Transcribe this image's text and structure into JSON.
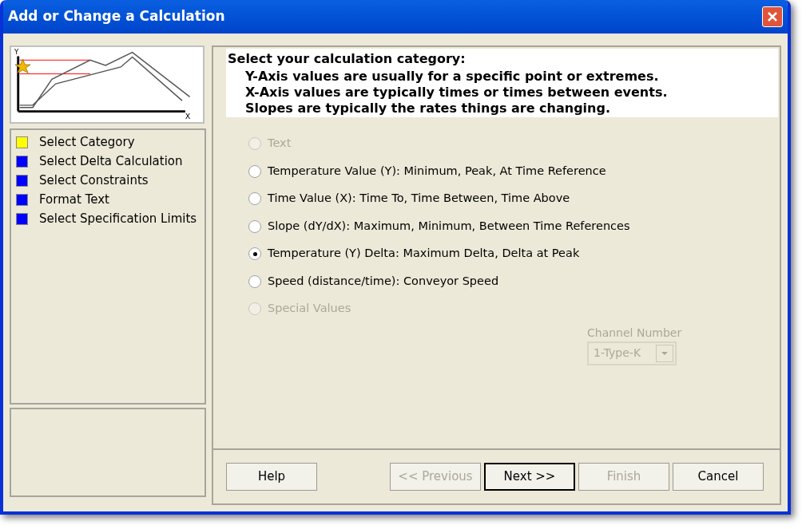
{
  "window": {
    "title": "Add or Change a Calculation"
  },
  "steps": [
    {
      "label": "Select Category",
      "color": "#ffff00"
    },
    {
      "label": "Select Delta Calculation",
      "color": "#0000ff"
    },
    {
      "label": "Select Constraints",
      "color": "#0000ff"
    },
    {
      "label": "Format Text",
      "color": "#0000ff"
    },
    {
      "label": "Select Specification Limits",
      "color": "#0000ff"
    }
  ],
  "chart_thumbnail": {
    "y_label": "Y",
    "x_label": "X"
  },
  "instructions": {
    "heading": "Select your calculation category:",
    "lines": [
      "Y-Axis values are usually for a specific point or extremes.",
      "X-Axis values are typically times or times between events.",
      "Slopes are typically the rates things are changing."
    ]
  },
  "options": [
    {
      "label": "Text",
      "selected": false,
      "disabled": true
    },
    {
      "label": "Temperature Value (Y):  Minimum, Peak, At Time Reference",
      "selected": false,
      "disabled": false
    },
    {
      "label": "Time Value (X):  Time To, Time Between, Time Above",
      "selected": false,
      "disabled": false
    },
    {
      "label": "Slope (dY/dX):  Maximum, Minimum, Between Time References",
      "selected": false,
      "disabled": false
    },
    {
      "label": "Temperature (Y) Delta:  Maximum Delta, Delta at Peak",
      "selected": true,
      "disabled": false
    },
    {
      "label": "Speed (distance/time): Conveyor Speed",
      "selected": false,
      "disabled": false
    },
    {
      "label": "Special  Values",
      "selected": false,
      "disabled": true
    }
  ],
  "channel": {
    "label": "Channel Number",
    "value": "1-Type-K",
    "disabled": true
  },
  "buttons": [
    {
      "label": "Help",
      "disabled": false,
      "default": false
    },
    {
      "label": "<< Previous",
      "disabled": true,
      "default": false
    },
    {
      "label": "Next >>",
      "disabled": false,
      "default": true
    },
    {
      "label": "Finish",
      "disabled": true,
      "default": false
    },
    {
      "label": "Cancel",
      "disabled": false,
      "default": false
    }
  ]
}
